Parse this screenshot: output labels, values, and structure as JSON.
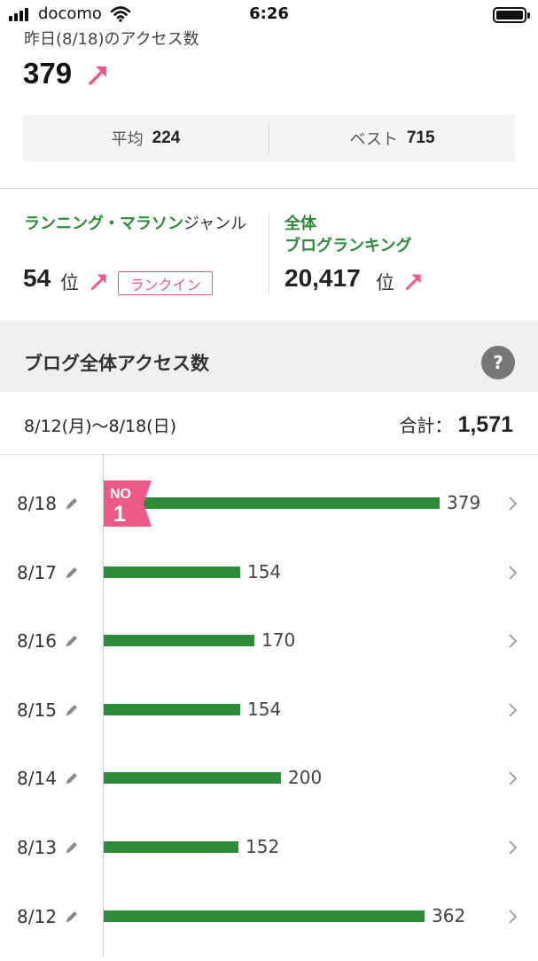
{
  "status_bar": {
    "carrier": "docomo",
    "time": "6:26"
  },
  "yesterday": {
    "label": "昨日(8/18)のアクセス数",
    "count": "379",
    "average_label": "平均",
    "average_value": "224",
    "best_label": "ベスト",
    "best_value": "715"
  },
  "ranking": {
    "genre_name": "ランニング・マラソン",
    "genre_suffix": "ジャンル",
    "genre_rank": "54",
    "rank_unit": "位",
    "rankin_badge": "ランクイン",
    "overall_line1": "全体",
    "overall_line2": "ブログランキング",
    "overall_rank": "20,417"
  },
  "blog_access": {
    "title": "ブログ全体アクセス数",
    "help": "?",
    "range": "8/12(月)〜8/18(日)",
    "total_label": "合計：",
    "total_value": "1,571",
    "no1_top": "NO",
    "no1_num": "1"
  },
  "chart_data": {
    "type": "bar",
    "orientation": "horizontal",
    "categories": [
      "8/18",
      "8/17",
      "8/16",
      "8/15",
      "8/14",
      "8/13",
      "8/12"
    ],
    "values": [
      379,
      154,
      170,
      154,
      200,
      152,
      362
    ],
    "xlim": [
      0,
      440
    ],
    "colors": {
      "bar": "#2e8b3a",
      "no1_badge": "#ee5a87",
      "up_arrow": "#ee5a87"
    }
  }
}
